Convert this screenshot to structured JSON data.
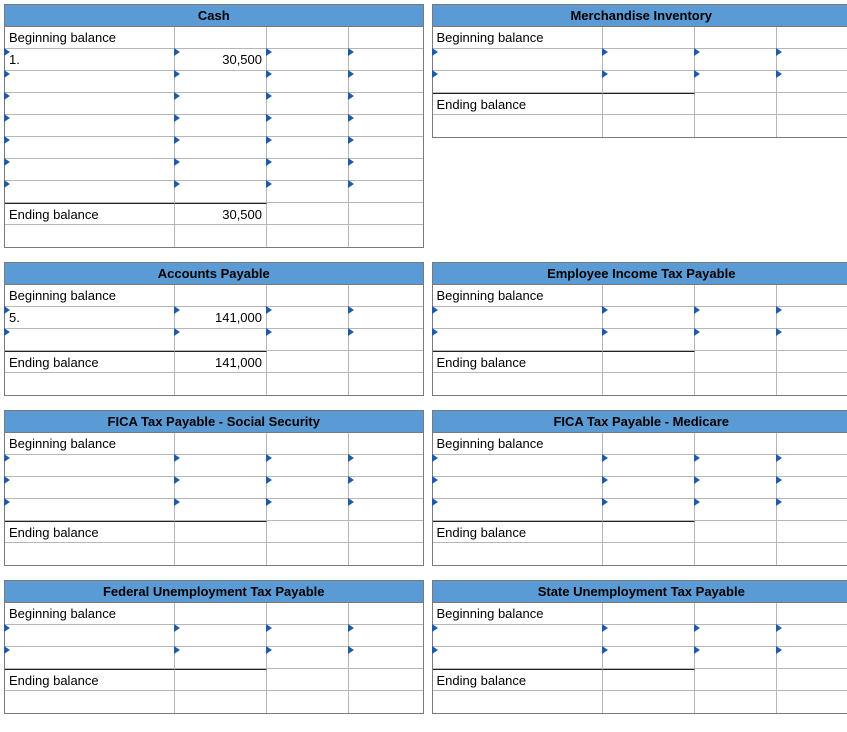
{
  "labels": {
    "beginning": "Beginning balance",
    "ending": "Ending balance"
  },
  "left": [
    {
      "title": "Cash",
      "rows": [
        {
          "kind": "begin",
          "label": "Beginning balance",
          "v1": "",
          "v2": "",
          "v3": "",
          "ticks": [
            false,
            false,
            false,
            false
          ]
        },
        {
          "kind": "data",
          "label": "1.",
          "v1": "30,500",
          "v2": "",
          "v3": "",
          "ticks": [
            true,
            true,
            true,
            true
          ]
        },
        {
          "kind": "data",
          "label": "",
          "v1": "",
          "v2": "",
          "v3": "",
          "ticks": [
            true,
            true,
            true,
            true
          ]
        },
        {
          "kind": "data",
          "label": "",
          "v1": "",
          "v2": "",
          "v3": "",
          "ticks": [
            true,
            true,
            true,
            true
          ]
        },
        {
          "kind": "data",
          "label": "",
          "v1": "",
          "v2": "",
          "v3": "",
          "ticks": [
            true,
            true,
            true,
            true
          ]
        },
        {
          "kind": "data",
          "label": "",
          "v1": "",
          "v2": "",
          "v3": "",
          "ticks": [
            true,
            true,
            true,
            true
          ]
        },
        {
          "kind": "data",
          "label": "",
          "v1": "",
          "v2": "",
          "v3": "",
          "ticks": [
            true,
            true,
            true,
            true
          ]
        },
        {
          "kind": "data",
          "label": "",
          "v1": "",
          "v2": "",
          "v3": "",
          "ticks": [
            true,
            true,
            true,
            true
          ]
        },
        {
          "kind": "end",
          "label": "Ending balance",
          "v1": "30,500",
          "v2": "",
          "v3": "",
          "ticks": [
            false,
            false,
            false,
            false
          ]
        },
        {
          "kind": "blank",
          "label": "",
          "v1": "",
          "v2": "",
          "v3": "",
          "ticks": [
            false,
            false,
            false,
            false
          ]
        }
      ]
    },
    {
      "title": "Accounts Payable",
      "rows": [
        {
          "kind": "begin",
          "label": "Beginning balance",
          "v1": "",
          "v2": "",
          "v3": "",
          "ticks": [
            false,
            false,
            false,
            false
          ]
        },
        {
          "kind": "data",
          "label": "5.",
          "v1": "141,000",
          "v2": "",
          "v3": "",
          "ticks": [
            true,
            true,
            true,
            true
          ]
        },
        {
          "kind": "data",
          "label": "",
          "v1": "",
          "v2": "",
          "v3": "",
          "ticks": [
            true,
            true,
            true,
            true
          ]
        },
        {
          "kind": "end",
          "label": "Ending balance",
          "v1": "141,000",
          "v2": "",
          "v3": "",
          "ticks": [
            false,
            false,
            false,
            false
          ]
        },
        {
          "kind": "blank",
          "label": "",
          "v1": "",
          "v2": "",
          "v3": "",
          "ticks": [
            false,
            false,
            false,
            false
          ]
        }
      ]
    },
    {
      "title": "FICA Tax Payable - Social Security",
      "rows": [
        {
          "kind": "begin",
          "label": "Beginning balance",
          "v1": "",
          "v2": "",
          "v3": "",
          "ticks": [
            false,
            false,
            false,
            false
          ]
        },
        {
          "kind": "data",
          "label": "",
          "v1": "",
          "v2": "",
          "v3": "",
          "ticks": [
            true,
            true,
            true,
            true
          ]
        },
        {
          "kind": "data",
          "label": "",
          "v1": "",
          "v2": "",
          "v3": "",
          "ticks": [
            true,
            true,
            true,
            true
          ]
        },
        {
          "kind": "data",
          "label": "",
          "v1": "",
          "v2": "",
          "v3": "",
          "ticks": [
            true,
            true,
            true,
            true
          ]
        },
        {
          "kind": "end",
          "label": "Ending balance",
          "v1": "",
          "v2": "",
          "v3": "",
          "ticks": [
            false,
            false,
            false,
            false
          ]
        },
        {
          "kind": "blank",
          "label": "",
          "v1": "",
          "v2": "",
          "v3": "",
          "ticks": [
            false,
            false,
            false,
            false
          ]
        }
      ]
    },
    {
      "title": "Federal Unemployment Tax Payable",
      "rows": [
        {
          "kind": "begin",
          "label": "Beginning balance",
          "v1": "",
          "v2": "",
          "v3": "",
          "ticks": [
            false,
            false,
            false,
            false
          ]
        },
        {
          "kind": "data",
          "label": "",
          "v1": "",
          "v2": "",
          "v3": "",
          "ticks": [
            true,
            true,
            true,
            true
          ]
        },
        {
          "kind": "data",
          "label": "",
          "v1": "",
          "v2": "",
          "v3": "",
          "ticks": [
            true,
            true,
            true,
            true
          ]
        },
        {
          "kind": "end",
          "label": "Ending balance",
          "v1": "",
          "v2": "",
          "v3": "",
          "ticks": [
            false,
            false,
            false,
            false
          ]
        },
        {
          "kind": "blank",
          "label": "",
          "v1": "",
          "v2": "",
          "v3": "",
          "ticks": [
            false,
            false,
            false,
            false
          ]
        }
      ]
    }
  ],
  "right": [
    {
      "title": "Merchandise Inventory",
      "rows": [
        {
          "kind": "begin",
          "label": "Beginning balance",
          "v1": "",
          "v2": "",
          "v3": "",
          "ticks": [
            false,
            false,
            false,
            false
          ]
        },
        {
          "kind": "data",
          "label": "",
          "v1": "",
          "v2": "",
          "v3": "",
          "ticks": [
            true,
            true,
            true,
            true
          ]
        },
        {
          "kind": "data",
          "label": "",
          "v1": "",
          "v2": "",
          "v3": "",
          "ticks": [
            true,
            true,
            true,
            true
          ]
        },
        {
          "kind": "end",
          "label": "Ending balance",
          "v1": "",
          "v2": "",
          "v3": "",
          "ticks": [
            false,
            false,
            false,
            false
          ]
        },
        {
          "kind": "blank",
          "label": "",
          "v1": "",
          "v2": "",
          "v3": "",
          "ticks": [
            false,
            false,
            false,
            false
          ]
        }
      ],
      "pad_after": true
    },
    {
      "title": "Employee Income Tax Payable",
      "rows": [
        {
          "kind": "begin",
          "label": "Beginning balance",
          "v1": "",
          "v2": "",
          "v3": "",
          "ticks": [
            false,
            false,
            false,
            false
          ]
        },
        {
          "kind": "data",
          "label": "",
          "v1": "",
          "v2": "",
          "v3": "",
          "ticks": [
            true,
            true,
            true,
            true
          ]
        },
        {
          "kind": "data",
          "label": "",
          "v1": "",
          "v2": "",
          "v3": "",
          "ticks": [
            true,
            true,
            true,
            true
          ]
        },
        {
          "kind": "end",
          "label": "Ending balance",
          "v1": "",
          "v2": "",
          "v3": "",
          "ticks": [
            false,
            false,
            false,
            false
          ]
        },
        {
          "kind": "blank",
          "label": "",
          "v1": "",
          "v2": "",
          "v3": "",
          "ticks": [
            false,
            false,
            false,
            false
          ]
        }
      ]
    },
    {
      "title": "FICA Tax Payable - Medicare",
      "rows": [
        {
          "kind": "begin",
          "label": "Beginning balance",
          "v1": "",
          "v2": "",
          "v3": "",
          "ticks": [
            false,
            false,
            false,
            false
          ]
        },
        {
          "kind": "data",
          "label": "",
          "v1": "",
          "v2": "",
          "v3": "",
          "ticks": [
            true,
            true,
            true,
            true
          ]
        },
        {
          "kind": "data",
          "label": "",
          "v1": "",
          "v2": "",
          "v3": "",
          "ticks": [
            true,
            true,
            true,
            true
          ]
        },
        {
          "kind": "data",
          "label": "",
          "v1": "",
          "v2": "",
          "v3": "",
          "ticks": [
            true,
            true,
            true,
            true
          ]
        },
        {
          "kind": "end",
          "label": "Ending balance",
          "v1": "",
          "v2": "",
          "v3": "",
          "ticks": [
            false,
            false,
            false,
            false
          ]
        },
        {
          "kind": "blank",
          "label": "",
          "v1": "",
          "v2": "",
          "v3": "",
          "ticks": [
            false,
            false,
            false,
            false
          ]
        }
      ]
    },
    {
      "title": "State Unemployment Tax Payable",
      "rows": [
        {
          "kind": "begin",
          "label": "Beginning balance",
          "v1": "",
          "v2": "",
          "v3": "",
          "ticks": [
            false,
            false,
            false,
            false
          ]
        },
        {
          "kind": "data",
          "label": "",
          "v1": "",
          "v2": "",
          "v3": "",
          "ticks": [
            true,
            true,
            true,
            true
          ]
        },
        {
          "kind": "data",
          "label": "",
          "v1": "",
          "v2": "",
          "v3": "",
          "ticks": [
            true,
            true,
            true,
            true
          ]
        },
        {
          "kind": "end",
          "label": "Ending balance",
          "v1": "",
          "v2": "",
          "v3": "",
          "ticks": [
            false,
            false,
            false,
            false
          ]
        },
        {
          "kind": "blank",
          "label": "",
          "v1": "",
          "v2": "",
          "v3": "",
          "ticks": [
            false,
            false,
            false,
            false
          ]
        }
      ]
    }
  ]
}
